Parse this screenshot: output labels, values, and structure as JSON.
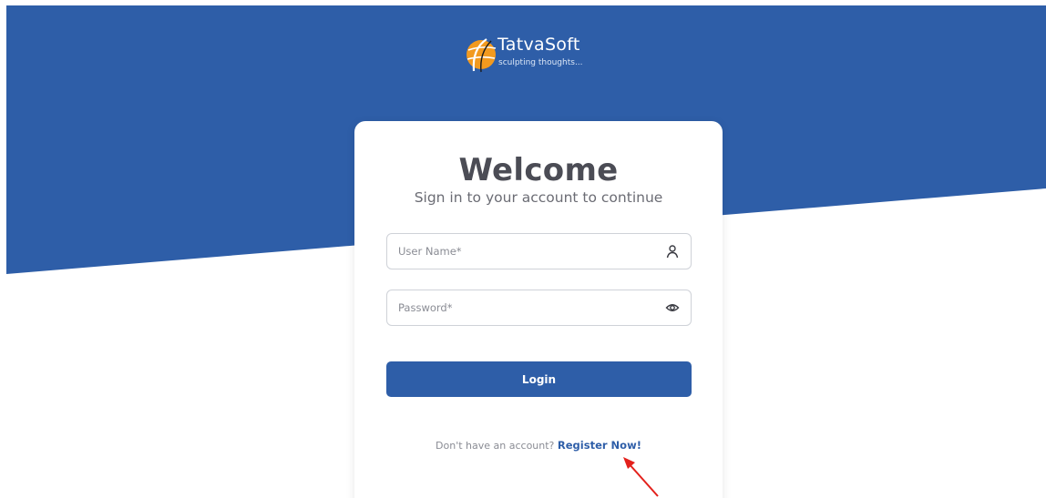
{
  "colors": {
    "brand_blue": "#2e5ea8",
    "background": "#ffffff",
    "heading": "#4b4c55",
    "annotation_arrow": "#e3211c"
  },
  "logo": {
    "name": "TatvaSoft",
    "tagline": "sculpting thoughts..."
  },
  "login": {
    "title": "Welcome",
    "subtitle": "Sign in to your account to continue",
    "username": {
      "placeholder": "User Name*",
      "value": "",
      "icon": "user-icon"
    },
    "password": {
      "placeholder": "Password*",
      "value": "",
      "icon": "eye-icon"
    },
    "submit_label": "Login",
    "register_prompt": "Don't have an account?",
    "register_link": "Register Now!"
  },
  "annotation": {
    "icon": "red-arrow-pointing-to-register-link"
  }
}
